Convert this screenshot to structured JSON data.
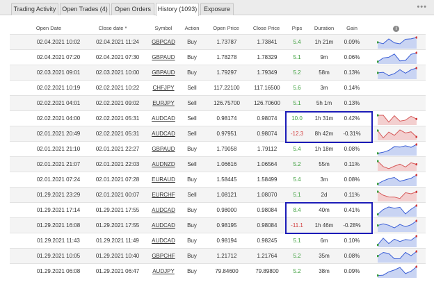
{
  "tabs": [
    {
      "label": "Trading Activity",
      "active": false
    },
    {
      "label": "Open Trades (4)",
      "active": false
    },
    {
      "label": "Open Orders",
      "active": false
    },
    {
      "label": "History (1093)",
      "active": true
    },
    {
      "label": "Exposure",
      "active": false
    }
  ],
  "more_icon": "more-dots-icon",
  "columns": [
    "Open Date",
    "Close date *",
    "Symbol",
    "Action",
    "Open Price",
    "Close Price",
    "Pips",
    "Duration",
    "Gain"
  ],
  "info_icon": "info-icon",
  "colors": {
    "highlight": "#1c1cb8",
    "positive": "#3a9e3a",
    "negative": "#d23b3b",
    "spark_buy_fill": "#c9d4f3",
    "spark_buy_line": "#3b5fd6",
    "spark_sell_fill": "#f3cfcf",
    "spark_sell_line": "#d65a5a"
  },
  "rows": [
    {
      "open_date": "02.04.2021 10:02",
      "close_date": "02.04.2021 11:24",
      "symbol": "GBPCAD",
      "action": "Buy",
      "open_price": "1.73787",
      "close_price": "1.73841",
      "pips": "5.4",
      "duration": "1h 21m",
      "gain": "0.09%",
      "spark": "buy"
    },
    {
      "open_date": "02.04.2021 07:20",
      "close_date": "02.04.2021 07:30",
      "symbol": "GBPAUD",
      "action": "Buy",
      "open_price": "1.78278",
      "close_price": "1.78329",
      "pips": "5.1",
      "duration": "9m",
      "gain": "0.06%",
      "spark": "buy"
    },
    {
      "open_date": "02.03.2021 09:01",
      "close_date": "02.03.2021 10:00",
      "symbol": "GBPAUD",
      "action": "Buy",
      "open_price": "1.79297",
      "close_price": "1.79349",
      "pips": "5.2",
      "duration": "58m",
      "gain": "0.13%",
      "spark": "buy"
    },
    {
      "open_date": "02.02.2021 10:19",
      "close_date": "02.02.2021 10:22",
      "symbol": "CHFJPY",
      "action": "Sell",
      "open_price": "117.22100",
      "close_price": "117.16500",
      "pips": "5.6",
      "duration": "3m",
      "gain": "0.14%",
      "spark": "none"
    },
    {
      "open_date": "02.02.2021 04:01",
      "close_date": "02.02.2021 09:02",
      "symbol": "EURJPY",
      "action": "Sell",
      "open_price": "126.75700",
      "close_price": "126.70600",
      "pips": "5.1",
      "duration": "5h 1m",
      "gain": "0.13%",
      "spark": "none"
    },
    {
      "open_date": "02.02.2021 04:00",
      "close_date": "02.02.2021 05:31",
      "symbol": "AUDCAD",
      "action": "Sell",
      "open_price": "0.98174",
      "close_price": "0.98074",
      "pips": "10.0",
      "duration": "1h 31m",
      "gain": "0.42%",
      "spark": "sell"
    },
    {
      "open_date": "02.01.2021 20:49",
      "close_date": "02.02.2021 05:31",
      "symbol": "AUDCAD",
      "action": "Sell",
      "open_price": "0.97951",
      "close_price": "0.98074",
      "pips": "-12.3",
      "duration": "8h 42m",
      "gain": "-0.31%",
      "spark": "sell"
    },
    {
      "open_date": "02.01.2021 21:10",
      "close_date": "02.01.2021 22:27",
      "symbol": "GBPAUD",
      "action": "Buy",
      "open_price": "1.79058",
      "close_price": "1.79112",
      "pips": "5.4",
      "duration": "1h 18m",
      "gain": "0.08%",
      "spark": "buy"
    },
    {
      "open_date": "02.01.2021 21:07",
      "close_date": "02.01.2021 22:03",
      "symbol": "AUDNZD",
      "action": "Sell",
      "open_price": "1.06616",
      "close_price": "1.06564",
      "pips": "5.2",
      "duration": "55m",
      "gain": "0.11%",
      "spark": "sell"
    },
    {
      "open_date": "02.01.2021 07:24",
      "close_date": "02.01.2021 07:28",
      "symbol": "EURAUD",
      "action": "Buy",
      "open_price": "1.58445",
      "close_price": "1.58499",
      "pips": "5.4",
      "duration": "3m",
      "gain": "0.08%",
      "spark": "buy"
    },
    {
      "open_date": "01.29.2021 23:29",
      "close_date": "02.01.2021 00:07",
      "symbol": "EURCHF",
      "action": "Sell",
      "open_price": "1.08121",
      "close_price": "1.08070",
      "pips": "5.1",
      "duration": "2d",
      "gain": "0.11%",
      "spark": "sell"
    },
    {
      "open_date": "01.29.2021 17:14",
      "close_date": "01.29.2021 17:55",
      "symbol": "AUDCAD",
      "action": "Buy",
      "open_price": "0.98000",
      "close_price": "0.98084",
      "pips": "8.4",
      "duration": "40m",
      "gain": "0.41%",
      "spark": "buy"
    },
    {
      "open_date": "01.29.2021 16:08",
      "close_date": "01.29.2021 17:55",
      "symbol": "AUDCAD",
      "action": "Buy",
      "open_price": "0.98195",
      "close_price": "0.98084",
      "pips": "-11.1",
      "duration": "1h 46m",
      "gain": "-0.28%",
      "spark": "buy"
    },
    {
      "open_date": "01.29.2021 11:43",
      "close_date": "01.29.2021 11:49",
      "symbol": "AUDCAD",
      "action": "Buy",
      "open_price": "0.98194",
      "close_price": "0.98245",
      "pips": "5.1",
      "duration": "6m",
      "gain": "0.10%",
      "spark": "buy"
    },
    {
      "open_date": "01.29.2021 10:05",
      "close_date": "01.29.2021 10:40",
      "symbol": "GBPCHF",
      "action": "Buy",
      "open_price": "1.21712",
      "close_price": "1.21764",
      "pips": "5.2",
      "duration": "35m",
      "gain": "0.08%",
      "spark": "buy"
    },
    {
      "open_date": "01.29.2021 06:08",
      "close_date": "01.29.2021 06:47",
      "symbol": "AUDJPY",
      "action": "Buy",
      "open_price": "79.84600",
      "close_price": "79.89800",
      "pips": "5.2",
      "duration": "38m",
      "gain": "0.09%",
      "spark": "buy"
    }
  ]
}
